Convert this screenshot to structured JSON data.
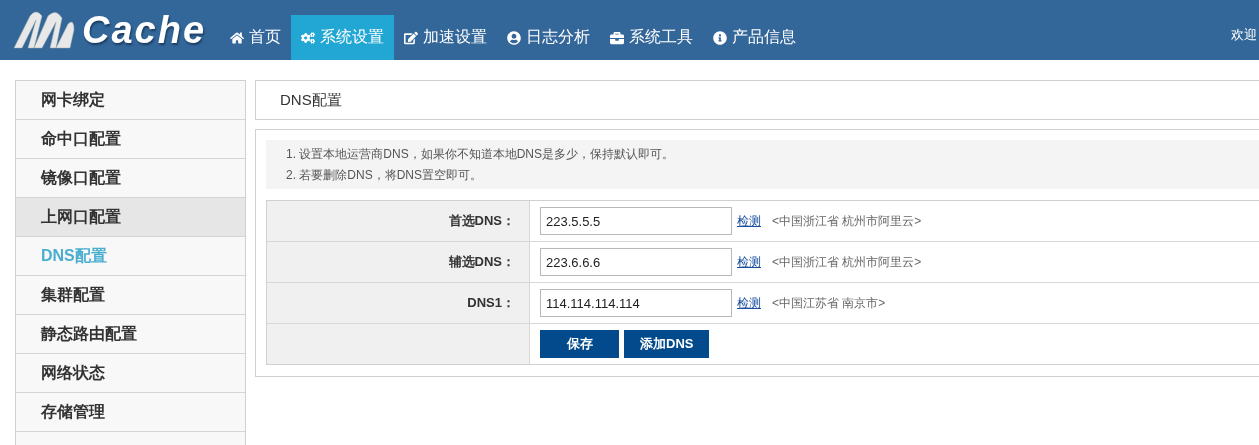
{
  "logo": {
    "text": "Cache"
  },
  "nav": [
    {
      "label": "首页",
      "selected": false
    },
    {
      "label": "系统设置",
      "selected": true
    },
    {
      "label": "加速设置",
      "selected": false
    },
    {
      "label": "日志分析",
      "selected": false
    },
    {
      "label": "系统工具",
      "selected": false
    },
    {
      "label": "产品信息",
      "selected": false
    }
  ],
  "welcome": "欢迎",
  "sidebar": {
    "items": [
      {
        "label": "网卡绑定",
        "selected": false,
        "highlighted": false
      },
      {
        "label": "命中口配置",
        "selected": false,
        "highlighted": false
      },
      {
        "label": "镜像口配置",
        "selected": false,
        "highlighted": false
      },
      {
        "label": "上网口配置",
        "selected": false,
        "highlighted": true
      },
      {
        "label": "DNS配置",
        "selected": true,
        "highlighted": false
      },
      {
        "label": "集群配置",
        "selected": false,
        "highlighted": false
      },
      {
        "label": "静态路由配置",
        "selected": false,
        "highlighted": false
      },
      {
        "label": "网络状态",
        "selected": false,
        "highlighted": false
      },
      {
        "label": "存储管理",
        "selected": false,
        "highlighted": false
      }
    ]
  },
  "panel_title": "DNS配置",
  "notes": [
    "1. 设置本地运营商DNS，如果你不知道本地DNS是多少，保持默认即可。",
    "2. 若要删除DNS，将DNS置空即可。"
  ],
  "dns_rows": [
    {
      "label": "首选DNS：",
      "value": "223.5.5.5",
      "link": "检测",
      "location": "<中国浙江省 杭州市阿里云>"
    },
    {
      "label": "辅选DNS：",
      "value": "223.6.6.6",
      "link": "检测",
      "location": "<中国浙江省 杭州市阿里云>"
    },
    {
      "label": "DNS1：",
      "value": "114.114.114.114",
      "link": "检测",
      "location": "<中国江苏省 南京市>"
    }
  ],
  "buttons": [
    "保存",
    "添加DNS"
  ]
}
